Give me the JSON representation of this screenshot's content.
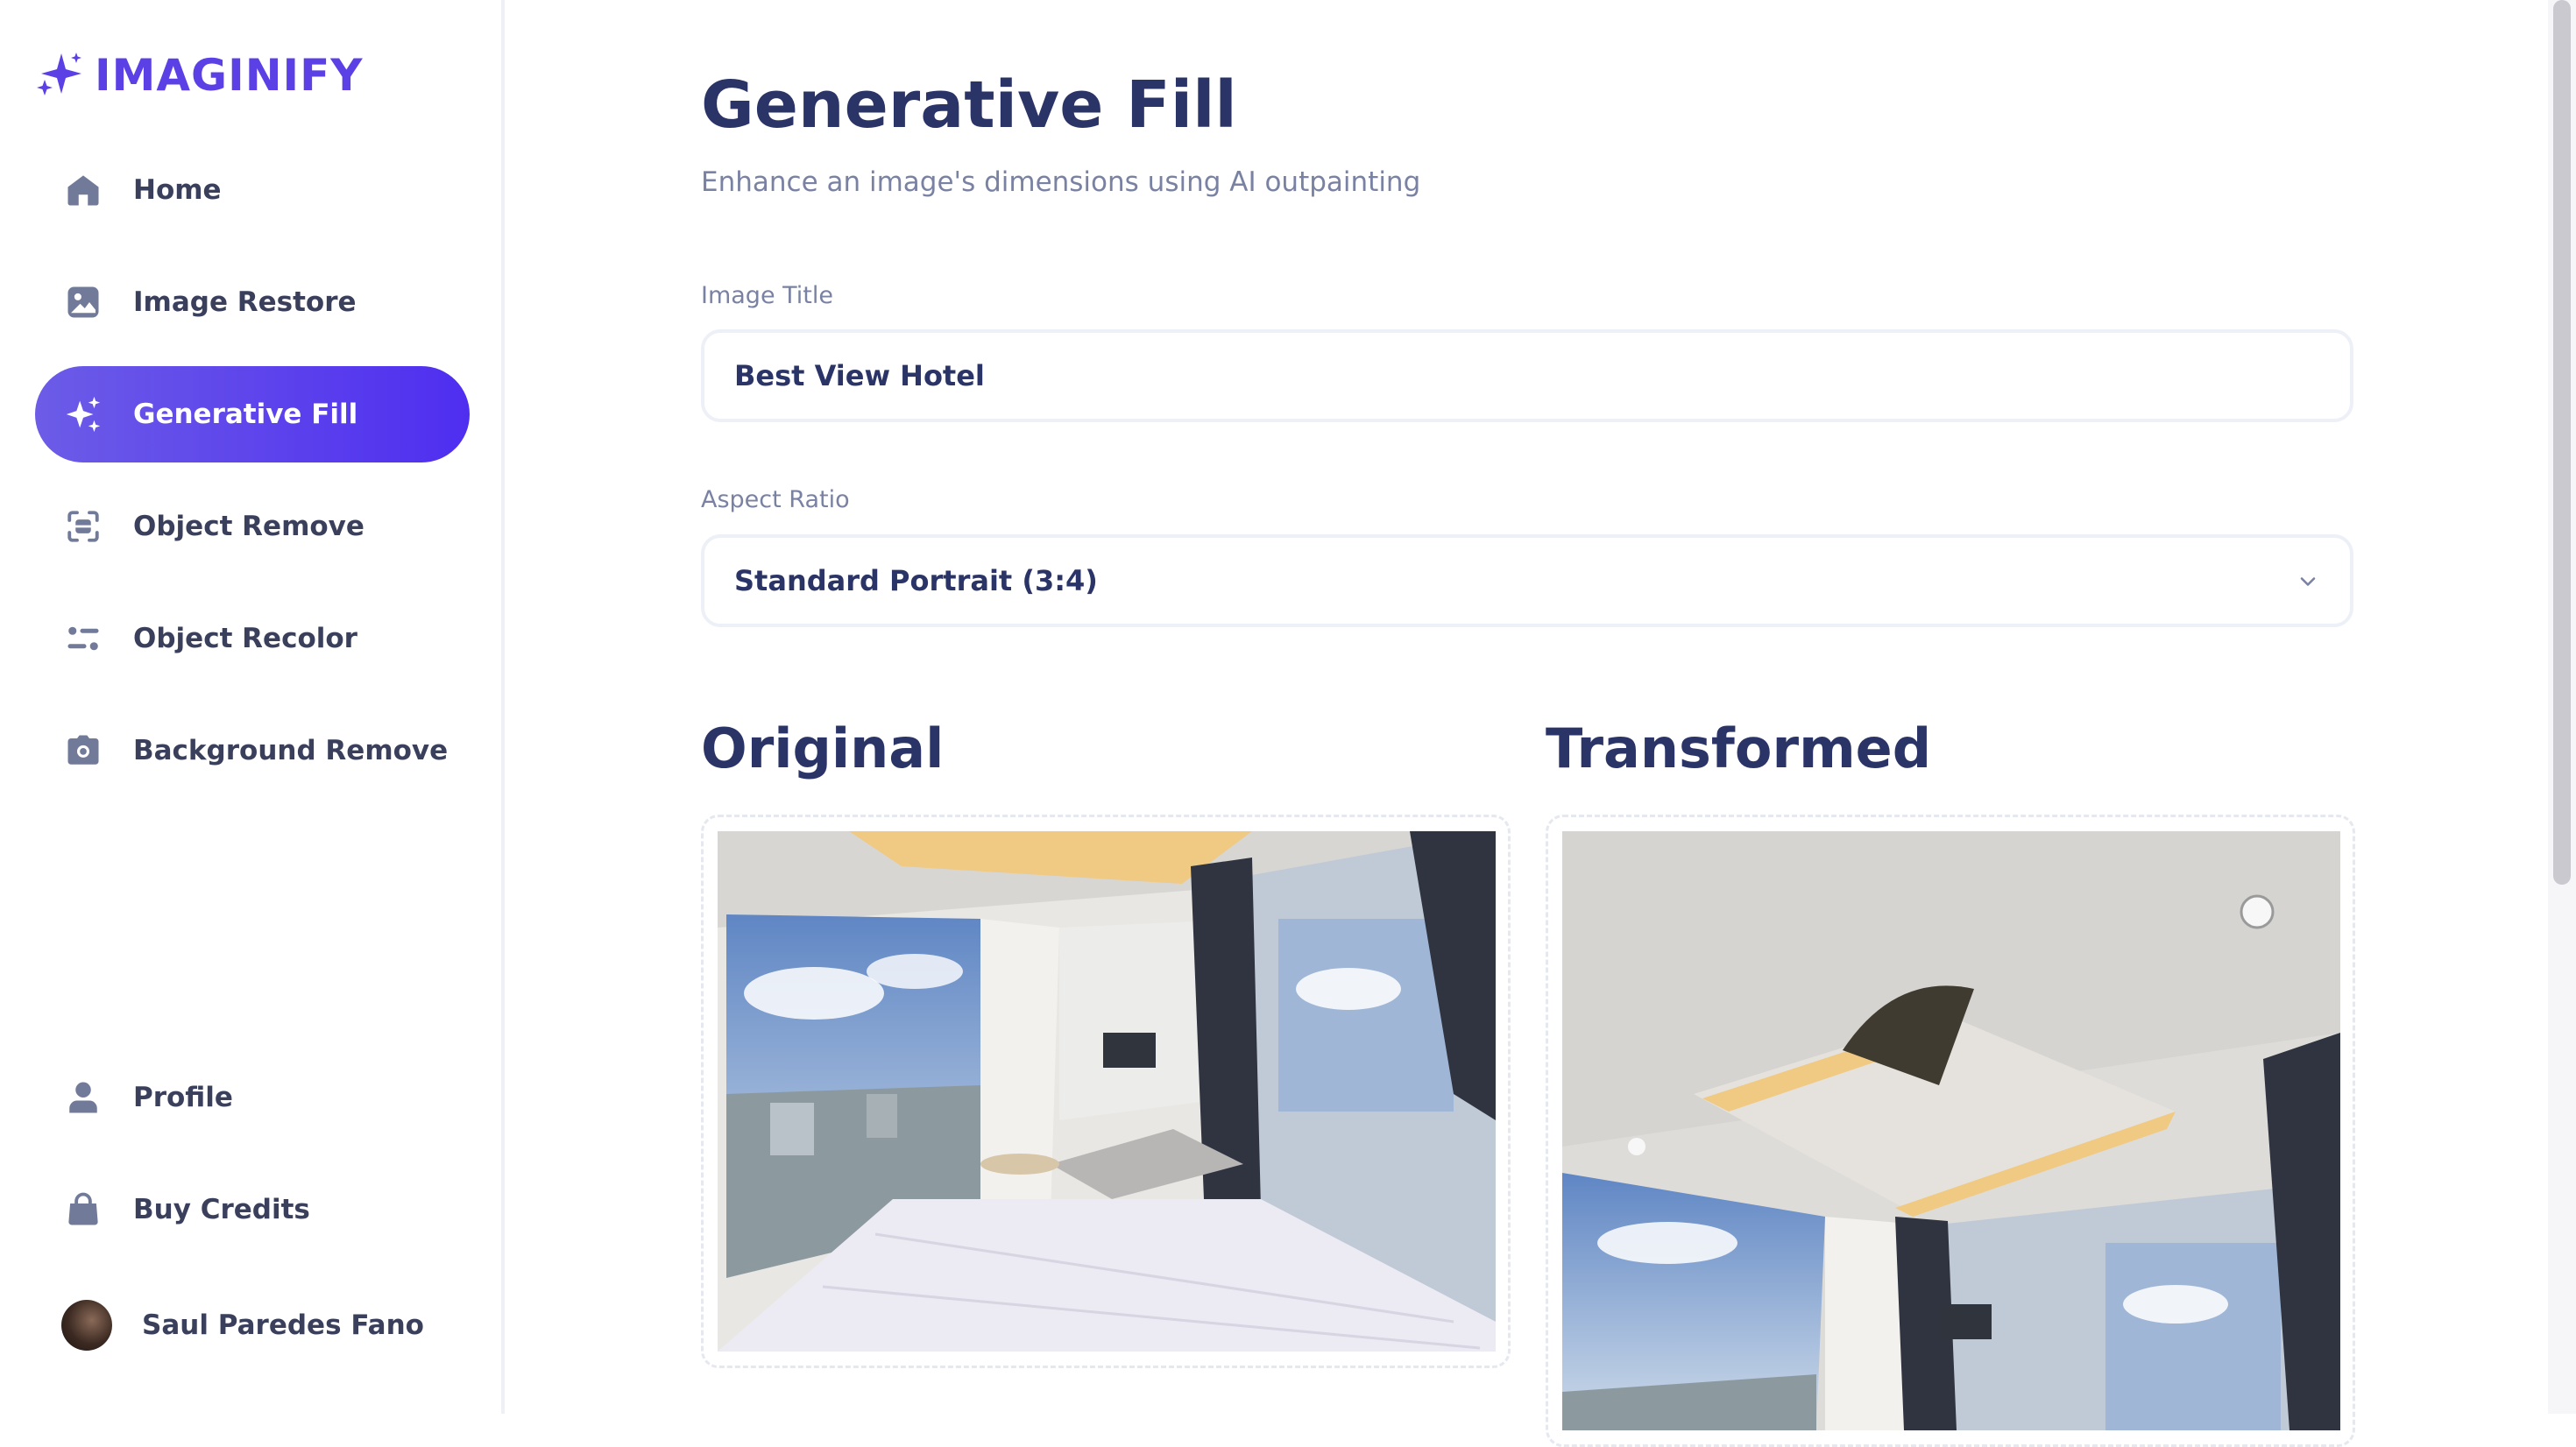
{
  "app": {
    "logo_text": "IMAGINIFY"
  },
  "sidebar": {
    "items": [
      {
        "label": "Home",
        "icon": "home-icon",
        "active": false
      },
      {
        "label": "Image Restore",
        "icon": "image-icon",
        "active": false
      },
      {
        "label": "Generative Fill",
        "icon": "sparkles-icon",
        "active": true
      },
      {
        "label": "Object Remove",
        "icon": "scan-icon",
        "active": false
      },
      {
        "label": "Object Recolor",
        "icon": "filter-icon",
        "active": false
      },
      {
        "label": "Background Remove",
        "icon": "camera-icon",
        "active": false
      }
    ],
    "bottom_items": [
      {
        "label": "Profile",
        "icon": "profile-icon"
      },
      {
        "label": "Buy Credits",
        "icon": "bag-icon"
      }
    ],
    "user": {
      "name": "Saul Paredes Fano"
    }
  },
  "page": {
    "title": "Generative Fill",
    "subtitle": "Enhance an image's dimensions using AI outpainting"
  },
  "form": {
    "image_title": {
      "label": "Image Title",
      "value": "Best View Hotel"
    },
    "aspect_ratio": {
      "label": "Aspect Ratio",
      "value": "Standard Portrait (3:4)"
    }
  },
  "images": {
    "original_title": "Original",
    "transformed_title": "Transformed"
  },
  "colors": {
    "accent": "#5b40e6",
    "active_gradient_start": "#6c5ce7",
    "active_gradient_end": "#4f2ef0",
    "heading": "#2b3467",
    "muted": "#7a82a3"
  }
}
